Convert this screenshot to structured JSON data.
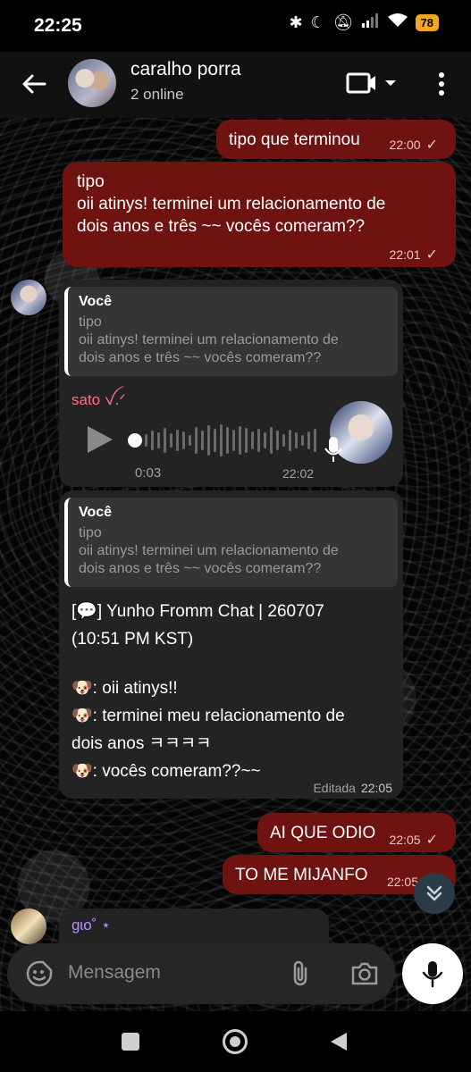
{
  "status_bar": {
    "time": "22:25",
    "battery": "78"
  },
  "header": {
    "title": "caralho porra",
    "subtitle": "2 online"
  },
  "messages": {
    "m1": {
      "text": "tipo que terminou",
      "time": "22:00"
    },
    "m2": {
      "line1": "tipo",
      "line2": "oii atinys! terminei um relacionamento de",
      "line3": "dois anos e três ~~ vocês comeram??",
      "time": "22:01"
    },
    "m3": {
      "reply_author": "Você",
      "reply_line1": "tipo",
      "reply_line2": "oii atinys! terminei um relacionamento de",
      "reply_line3": "dois anos e três ~~ vocês comeram??",
      "sender": "sato ꪜ.ᐟ",
      "voice_duration": "0:03",
      "time": "22:02"
    },
    "m4": {
      "reply_author": "Você",
      "reply_line1": "tipo",
      "reply_line2": "oii atinys! terminei um relacionamento de",
      "reply_line3": "dois anos e três ~~ vocês comeram??",
      "line1": "[💬] Yunho Fromm Chat | 260707",
      "line2": "(10:51 PM KST)",
      "line3": "🐶: oii atinys!!",
      "line4": "🐶: terminei meu relacionamento de",
      "line5": "dois anos ㅋㅋㅋㅋ",
      "line6": "🐶: vocês comeram??~~",
      "edited": "Editada",
      "time": "22:05"
    },
    "m5": {
      "text": "AI QUE ODIO",
      "time": "22:05"
    },
    "m6": {
      "text": "TO ME MIJANFO",
      "time": "22:05"
    },
    "m7": {
      "sender": "gɩo˚ ⋆"
    }
  },
  "input": {
    "placeholder": "Mensagem"
  },
  "colors": {
    "outgoing_bubble": "#6e1310",
    "incoming_bubble": "#232323",
    "sender_sato": "#ff6f8a",
    "sender_gio": "#b48cff",
    "battery": "#f5a623"
  }
}
